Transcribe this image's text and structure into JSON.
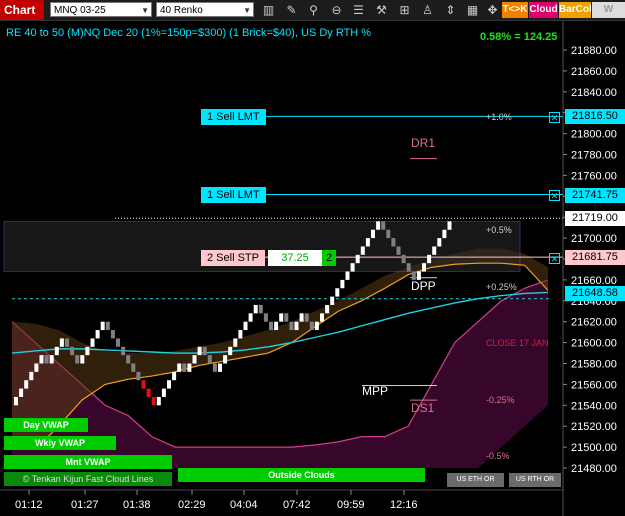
{
  "toolbar": {
    "chart_tab": "Chart",
    "instrument": "MNQ 03-25",
    "bar_type": "40 Renko",
    "icons": [
      "bar-style-icon",
      "drawing-tool-icon",
      "crosshair-icon",
      "zoom-icon",
      "zoom-out-icon",
      "properties-icon",
      "tool-icon",
      "indicators-icon",
      "strategies-icon",
      "scroll-icon"
    ],
    "tk_btn": "T<>K",
    "cloud_btn": "Cloud",
    "barcol_btn": "BarCol",
    "wvwa_btn": "W VWA"
  },
  "info": {
    "title": "RE 40 to 50 (M)NQ Dec 20 (1%=150p=$300) (1 Brick=$40), US Dy RTH %",
    "pct_value": "0.58% = 124.25"
  },
  "orders": {
    "sell_lmt_1": "1 Sell LMT",
    "sell_lmt_2": "1 Sell LMT",
    "sell_stp": "2 Sell STP",
    "stp_value": "37.25",
    "stp_qty": "2"
  },
  "price_tags": {
    "t1": "21816.50",
    "t2": "21741.75",
    "t3": "21719.00",
    "t4": "21681.75",
    "t5": "21648.58"
  },
  "pivots": {
    "dr1": "DR1",
    "dpp": "DPP",
    "mpp": "MPP",
    "ds1": "DS1",
    "close": "CLOSE 17 JAN"
  },
  "pct_labels": {
    "p1": "+1.0%",
    "p05": "+0.5%",
    "p025": "+0.25%",
    "m025": "-0.25%",
    "m05": "-0.5%"
  },
  "buttons": {
    "day_vwap": "Day VWAP",
    "wkly_vwap": "Wkly VWAP",
    "mnt_vwap": "Mnt VWAP",
    "tenkan": "Tenkan Kijun Fast Cloud Lines",
    "outside": "Outside Clouds",
    "us_eth": "US ETH OR",
    "us_rth": "US RTH OR",
    "copyright": "©"
  },
  "chart_data": {
    "type": "line",
    "y_ticks": [
      "21880.00",
      "21860.00",
      "21840.00",
      "21820.00",
      "21800.00",
      "21780.00",
      "21760.00",
      "21740.00",
      "21720.00",
      "21700.00",
      "21680.00",
      "21660.00",
      "21640.00",
      "21620.00",
      "21600.00",
      "21580.00",
      "21560.00",
      "21540.00",
      "21520.00",
      "21500.00",
      "21480.00"
    ],
    "x_ticks": [
      "01:12",
      "01:27",
      "01:38",
      "02:29",
      "04:04",
      "07:42",
      "09:59",
      "12:16"
    ],
    "ylim": [
      21472,
      21893
    ],
    "renko_bricks": [
      [
        "u",
        21548
      ],
      [
        "u",
        21556
      ],
      [
        "u",
        21564
      ],
      [
        "u",
        21572
      ],
      [
        "u",
        21580
      ],
      [
        "u",
        21588
      ],
      [
        "d",
        21580
      ],
      [
        "u",
        21588
      ],
      [
        "u",
        21596
      ],
      [
        "u",
        21604
      ],
      [
        "d",
        21596
      ],
      [
        "d",
        21588
      ],
      [
        "d",
        21580
      ],
      [
        "u",
        21588
      ],
      [
        "u",
        21596
      ],
      [
        "u",
        21604
      ],
      [
        "u",
        21612
      ],
      [
        "u",
        21620
      ],
      [
        "d",
        21612
      ],
      [
        "d",
        21604
      ],
      [
        "d",
        21596
      ],
      [
        "d",
        21588
      ],
      [
        "d",
        21580
      ],
      [
        "d",
        21572
      ],
      [
        "d",
        21564
      ],
      [
        "d",
        21556
      ],
      [
        "d",
        21548
      ],
      [
        "d",
        21540
      ],
      [
        "u",
        21548
      ],
      [
        "u",
        21556
      ],
      [
        "u",
        21564
      ],
      [
        "u",
        21572
      ],
      [
        "u",
        21580
      ],
      [
        "d",
        21572
      ],
      [
        "u",
        21580
      ],
      [
        "u",
        21588
      ],
      [
        "u",
        21596
      ],
      [
        "d",
        21588
      ],
      [
        "d",
        21580
      ],
      [
        "d",
        21572
      ],
      [
        "u",
        21580
      ],
      [
        "u",
        21588
      ],
      [
        "u",
        21596
      ],
      [
        "u",
        21604
      ],
      [
        "u",
        21612
      ],
      [
        "u",
        21620
      ],
      [
        "u",
        21628
      ],
      [
        "u",
        21636
      ],
      [
        "d",
        21628
      ],
      [
        "d",
        21620
      ],
      [
        "d",
        21612
      ],
      [
        "u",
        21620
      ],
      [
        "u",
        21628
      ],
      [
        "d",
        21620
      ],
      [
        "d",
        21612
      ],
      [
        "u",
        21620
      ],
      [
        "u",
        21628
      ],
      [
        "d",
        21620
      ],
      [
        "d",
        21612
      ],
      [
        "u",
        21620
      ],
      [
        "u",
        21628
      ],
      [
        "u",
        21636
      ],
      [
        "u",
        21644
      ],
      [
        "u",
        21652
      ],
      [
        "u",
        21660
      ],
      [
        "u",
        21668
      ],
      [
        "u",
        21676
      ],
      [
        "u",
        21684
      ],
      [
        "u",
        21692
      ],
      [
        "u",
        21700
      ],
      [
        "u",
        21708
      ],
      [
        "u",
        21716
      ],
      [
        "d",
        21708
      ],
      [
        "d",
        21700
      ],
      [
        "d",
        21692
      ],
      [
        "d",
        21684
      ],
      [
        "d",
        21676
      ],
      [
        "d",
        21668
      ],
      [
        "d",
        21660
      ],
      [
        "u",
        21668
      ],
      [
        "u",
        21676
      ],
      [
        "u",
        21684
      ],
      [
        "u",
        21692
      ],
      [
        "u",
        21700
      ],
      [
        "u",
        21708
      ],
      [
        "u",
        21716
      ]
    ],
    "vwap_line": [
      21590,
      21592,
      21594,
      21594,
      21593,
      21592,
      21591,
      21590,
      21590,
      21591,
      21593,
      21596,
      21600,
      21605,
      21610,
      21616,
      21622,
      21628,
      21633,
      21638,
      21642,
      21645,
      21647,
      21648
    ],
    "orange_line": [
      21500,
      21498,
      21520,
      21545,
      21560,
      21565,
      21568,
      21572,
      21578,
      21582,
      21586,
      21590,
      21600,
      21615,
      21630,
      21640,
      21652,
      21665,
      21672,
      21675,
      21676,
      21676,
      21674,
      21650
    ],
    "cyan_dashed_level": 21642,
    "cloud_top": [
      21620,
      21618,
      21612,
      21600,
      21592,
      21590,
      21590,
      21592,
      21596,
      21600,
      21606,
      21612,
      21620,
      21630,
      21640,
      21652,
      21664,
      21672,
      21680,
      21685,
      21690,
      21690,
      21685,
      21672
    ],
    "cloud_bottom": [
      21480,
      21480,
      21480,
      21480,
      21480,
      21480,
      21480,
      21480,
      21480,
      21480,
      21480,
      21480,
      21480,
      21480,
      21480,
      21480,
      21480,
      21480,
      21480,
      21480,
      21480,
      21480,
      21480,
      21480
    ],
    "lower_cloud_top": [
      21620,
      21600,
      21580,
      21560,
      21540,
      21530,
      21510,
      21500,
      21500,
      21500,
      21500,
      21500,
      21500,
      21502,
      21505,
      21510,
      21510,
      21520,
      21560,
      21600,
      21620,
      21640,
      21652,
      21660
    ],
    "lower_cloud_bottom": [
      21480,
      21480,
      21480,
      21480,
      21480,
      21480,
      21480,
      21480,
      21480,
      21480,
      21480,
      21480,
      21480,
      21480,
      21480,
      21480,
      21480,
      21480,
      21480,
      21480,
      21480,
      21500,
      21520,
      21540
    ]
  }
}
